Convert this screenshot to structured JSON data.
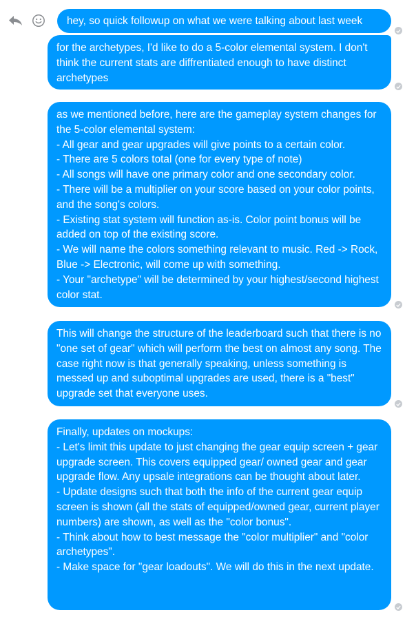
{
  "toolbar": {
    "reply_icon": "reply-arrow-icon",
    "emoji_icon": "smiley-face-icon"
  },
  "colors": {
    "bubble": "#0099ff",
    "bubble_text": "#ffffff",
    "read_receipt": "#c8ccd1",
    "icon": "#8a8d91"
  },
  "messages": [
    {
      "text": "hey, so quick followup on what we were talking about last week"
    },
    {
      "text": "for the archetypes, I'd like to do a 5-color elemental system. I don't think the current stats are diffrentiated enough to have distinct archetypes"
    },
    {
      "text": "as we mentioned before, here are the gameplay system changes for the 5-color elemental system:\n- All gear and gear upgrades will give points to a certain color.\n- There are 5 colors total (one for every type of note)\n- All songs will have one primary color and one secondary color.\n- There will be a multiplier on your score based on your color points, and the song's colors.\n- Existing stat system will function as-is. Color point bonus will be added on top of the existing score.\n- We will name the colors something relevant to music. Red -> Rock, Blue -> Electronic, will come up with something.\n- Your \"archetype\" will be determined by your highest/second highest color stat."
    },
    {
      "text": "This will change the structure of the leaderboard such that there is no \"one set of gear\" which will perform the best on almost any song. The case right now is that generally speaking, unless something is messed up and suboptimal upgrades are used, there is a \"best\" upgrade set that everyone uses."
    },
    {
      "text": "Finally, updates on mockups:\n- Let's limit this update to just changing the gear equip screen + gear upgrade screen. This covers equipped gear/ owned gear and gear upgrade flow. Any upsale integrations can be thought about later.\n- Update designs such that both the info of the current gear equip screen is shown (all the stats of equipped/owned gear, current player numbers) are shown, as well as the \"color bonus\".\n- Think about how to best message the \"color multiplier\" and \"color archetypes\".\n- Make space for \"gear loadouts\". We will do this in the next update."
    }
  ]
}
